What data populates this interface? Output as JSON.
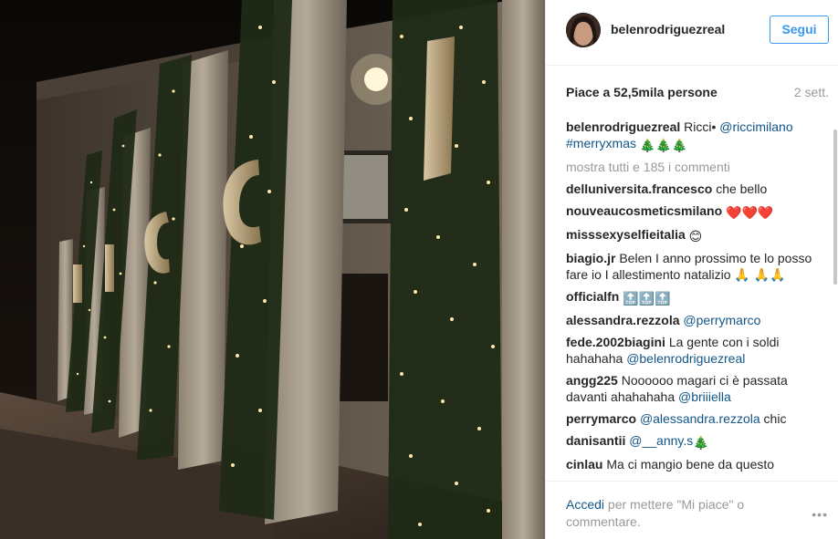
{
  "header": {
    "username": "belenrodriguezreal",
    "follow_label": "Segui"
  },
  "stats": {
    "likes": "Piace a 52,5mila persone",
    "time_ago": "2 sett."
  },
  "caption": {
    "user": "belenrodriguezreal",
    "text": "Ricci• ",
    "mention": "@riccimilano",
    "hashtag": "#merryxmas",
    "emoji": "🎄🎄🎄"
  },
  "load_more": "mostra tutti e 185 i commenti",
  "comments": [
    {
      "user": "delluniversita.francesco",
      "text": "che bello"
    },
    {
      "user": "nouveaucosmeticsmilano",
      "text": "❤️❤️❤️"
    },
    {
      "user": "misssexyselfieitalia",
      "text": "😊"
    },
    {
      "user": "biagio.jr",
      "text": "Belen I anno prossimo te lo posso fare io I allestimento natalizio 🙏 🙏🙏"
    },
    {
      "user": "officialfn",
      "text": "🔝🔝🔝"
    },
    {
      "user": "alessandra.rezzola",
      "text": "",
      "mention": "@perrymarco"
    },
    {
      "user": "fede.2002biagini",
      "text": "La gente con i soldi hahahaha ",
      "mention": "@belenrodriguezreal"
    },
    {
      "user": "angg225",
      "text": "Noooooo magari ci è passata davanti ahahahaha ",
      "mention": "@briiiella"
    },
    {
      "user": "perrymarco",
      "text": "",
      "mention": "@alessandra.rezzola",
      "after": " chic"
    },
    {
      "user": "danisantii",
      "text": "",
      "mention": "@__anny.s",
      "after": " 🎄"
    },
    {
      "user": "cinlau",
      "text": "Ma ci mangio bene da questo"
    }
  ],
  "footer": {
    "login_link": "Accedi",
    "prompt": " per mettere \"Mi piace\" o commentare.",
    "more": "•••"
  },
  "colors": {
    "accent": "#3897f0",
    "link": "#125688",
    "muted": "#999999"
  }
}
